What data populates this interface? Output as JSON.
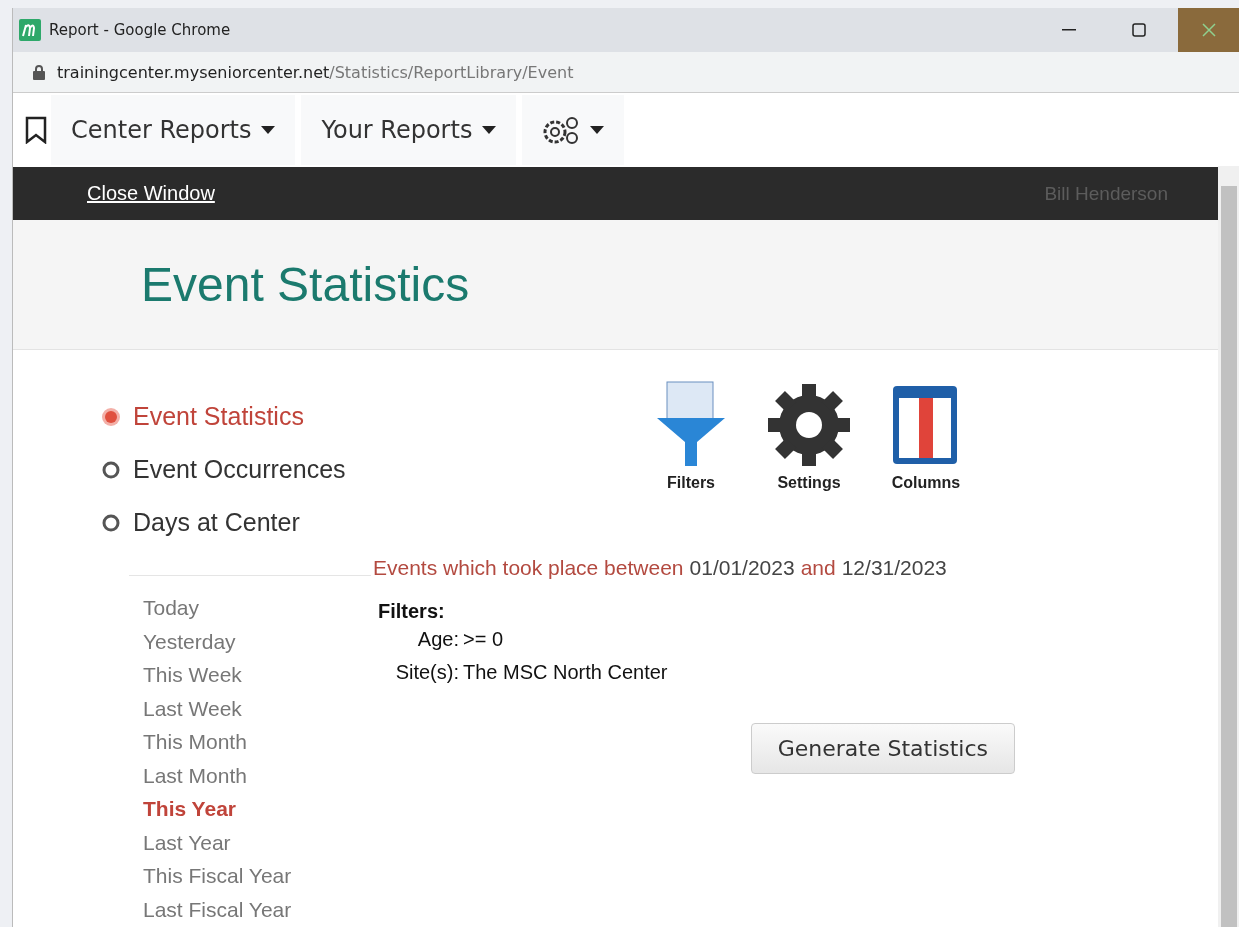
{
  "window": {
    "title": "Report - Google Chrome",
    "url_host": "trainingcenter.myseniorcenter.net",
    "url_path": "/Statistics/ReportLibrary/Event"
  },
  "nav": {
    "menus": [
      {
        "label": "Center Reports",
        "kind": "text"
      },
      {
        "label": "Your Reports",
        "kind": "text"
      },
      {
        "kind": "gears"
      }
    ]
  },
  "top_bar": {
    "link": "Close Window",
    "user": "Bill Henderson"
  },
  "page_title": "Event Statistics",
  "report_types": [
    {
      "label": "Event Statistics",
      "selected": true
    },
    {
      "label": "Event Occurrences",
      "selected": false
    },
    {
      "label": "Days at Center",
      "selected": false
    }
  ],
  "tools": [
    {
      "label": "Filters",
      "kind": "filter"
    },
    {
      "label": "Settings",
      "kind": "gear"
    },
    {
      "label": "Columns",
      "kind": "columns"
    }
  ],
  "ranges": [
    {
      "label": "Today",
      "selected": false
    },
    {
      "label": "Yesterday",
      "selected": false
    },
    {
      "label": "This Week",
      "selected": false
    },
    {
      "label": "Last Week",
      "selected": false
    },
    {
      "label": "This Month",
      "selected": false
    },
    {
      "label": "Last Month",
      "selected": false
    },
    {
      "label": "This Year",
      "selected": true
    },
    {
      "label": "Last Year",
      "selected": false
    },
    {
      "label": "This Fiscal Year",
      "selected": false
    },
    {
      "label": "Last Fiscal Year",
      "selected": false
    }
  ],
  "summary": {
    "prefix": "Events which took place between",
    "start": "01/01/2023",
    "joiner": "and",
    "end": "12/31/2023"
  },
  "filters": {
    "heading": "Filters:",
    "items": [
      {
        "key": "Age:",
        "value": ">= 0"
      },
      {
        "key": "Site(s):",
        "value": "The MSC North Center"
      }
    ]
  },
  "generate_button": "Generate Statistics"
}
